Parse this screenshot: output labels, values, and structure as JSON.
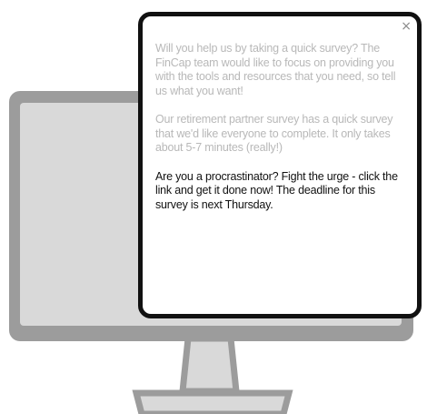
{
  "popup": {
    "close_label": "×",
    "paragraph_1": "Will you help us by taking a quick survey? The FinCap team would like to focus on providing you with the tools and resources that you need, so tell us what you want!",
    "paragraph_2": "Our retirement partner survey has a quick survey that we'd like everyone to complete. It only takes about 5-7 minutes (really!)",
    "paragraph_3": "Are you a procrastinator? Fight the urge - click the link and get it done now! The deadline for this survey is next Thursday."
  },
  "colors": {
    "monitor_frame": "#9c9c9c",
    "monitor_screen": "#d9d9d9",
    "popup_border": "#111111",
    "muted_text": "#b8b8b8",
    "primary_text": "#111111"
  },
  "icons": {
    "close": "close-icon",
    "monitor": "monitor-illustration"
  }
}
